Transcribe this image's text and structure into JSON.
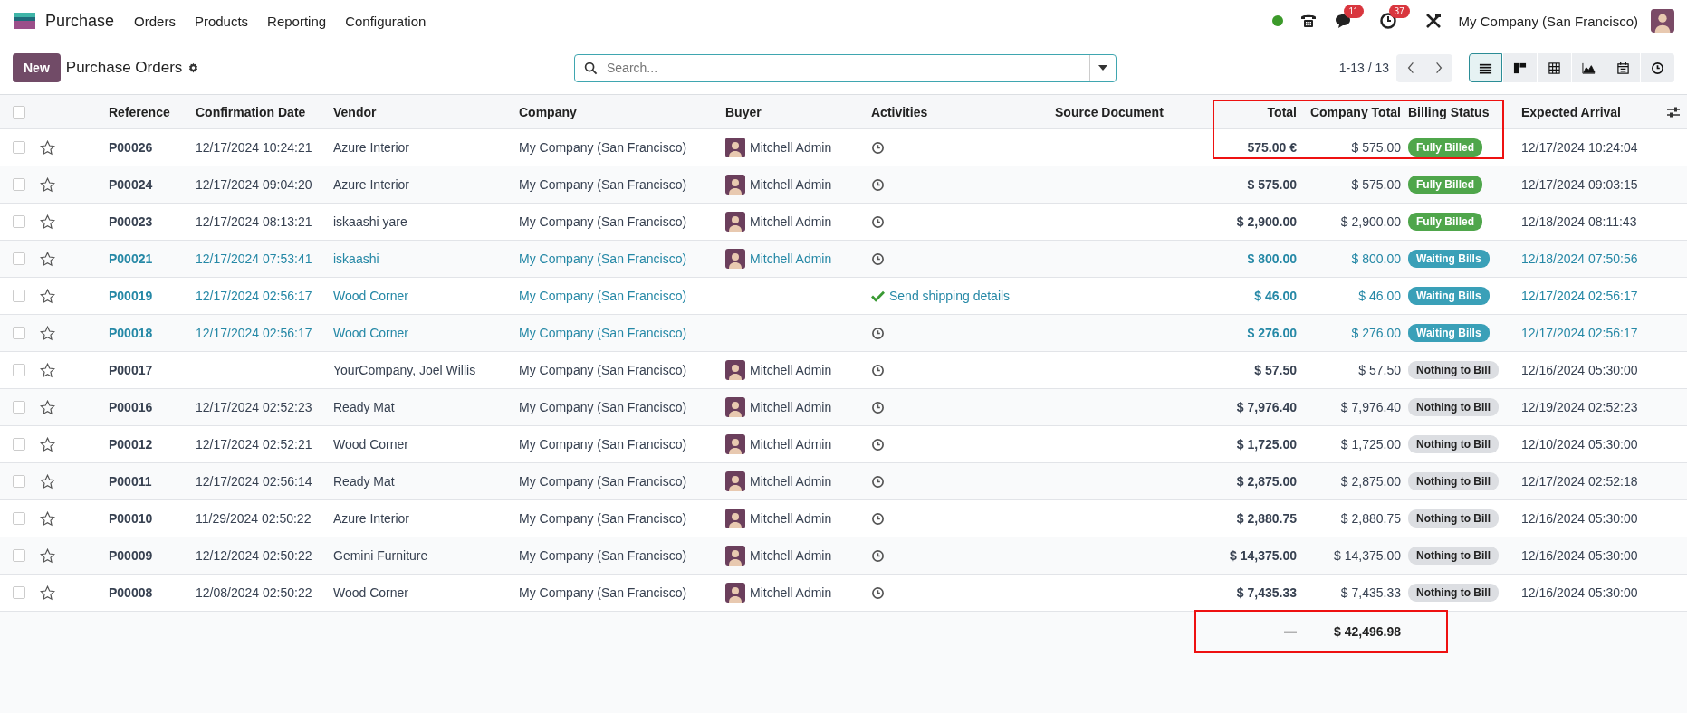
{
  "navbar": {
    "app_name": "Purchase",
    "menus": [
      "Orders",
      "Products",
      "Reporting",
      "Configuration"
    ],
    "status_online": true,
    "messages_count": "11",
    "activities_count": "37",
    "company": "My Company (San Francisco)"
  },
  "control_panel": {
    "new_button": "New",
    "title": "Purchase Orders",
    "search": {
      "placeholder": "Search..."
    },
    "pager": "1-13 / 13",
    "views": [
      {
        "kind": "list",
        "selected": true
      },
      {
        "kind": "kanban",
        "selected": false
      },
      {
        "kind": "pivot",
        "selected": false
      },
      {
        "kind": "graph",
        "selected": false
      },
      {
        "kind": "calendar",
        "selected": false
      },
      {
        "kind": "activity",
        "selected": false
      }
    ]
  },
  "table": {
    "header_checked": false,
    "columns": [
      "Reference",
      "Confirmation Date",
      "Vendor",
      "Company",
      "Buyer",
      "Activities",
      "Source Document",
      "Total",
      "Company Total",
      "Billing Status",
      "Expected Arrival"
    ],
    "rows": [
      {
        "checked": false,
        "starred": false,
        "highlighted": false,
        "reference": "P00026",
        "confirmation_date": "12/17/2024 10:24:21",
        "vendor": "Azure Interior",
        "company": "My Company (San Francisco)",
        "buyer": "Mitchell Admin",
        "activity": {
          "kind": "clock"
        },
        "total": "575.00 €",
        "company_total": "$ 575.00",
        "billing": {
          "label": "Fully Billed",
          "color": "#4fa64b"
        },
        "expected_arrival": "12/17/2024 10:24:04"
      },
      {
        "checked": false,
        "starred": false,
        "highlighted": false,
        "reference": "P00024",
        "confirmation_date": "12/17/2024 09:04:20",
        "vendor": "Azure Interior",
        "company": "My Company (San Francisco)",
        "buyer": "Mitchell Admin",
        "activity": {
          "kind": "clock"
        },
        "total": "$ 575.00",
        "company_total": "$ 575.00",
        "billing": {
          "label": "Fully Billed",
          "color": "#4fa64b"
        },
        "expected_arrival": "12/17/2024 09:03:15"
      },
      {
        "checked": false,
        "starred": false,
        "highlighted": false,
        "reference": "P00023",
        "confirmation_date": "12/17/2024 08:13:21",
        "vendor": "iskaashi yare",
        "company": "My Company (San Francisco)",
        "buyer": "Mitchell Admin",
        "activity": {
          "kind": "clock"
        },
        "total": "$ 2,900.00",
        "company_total": "$ 2,900.00",
        "billing": {
          "label": "Fully Billed",
          "color": "#4fa64b"
        },
        "expected_arrival": "12/18/2024 08:11:43"
      },
      {
        "checked": false,
        "starred": false,
        "highlighted": true,
        "reference": "P00021",
        "confirmation_date": "12/17/2024 07:53:41",
        "vendor": "iskaashi",
        "company": "My Company (San Francisco)",
        "buyer": "Mitchell Admin",
        "activity": {
          "kind": "clock"
        },
        "total": "$ 800.00",
        "company_total": "$ 800.00",
        "billing": {
          "label": "Waiting Bills",
          "color": "#3aa0b8"
        },
        "expected_arrival": "12/18/2024 07:50:56"
      },
      {
        "checked": false,
        "starred": false,
        "highlighted": true,
        "reference": "P00019",
        "confirmation_date": "12/17/2024 02:56:17",
        "vendor": "Wood Corner",
        "company": "My Company (San Francisco)",
        "activity": {
          "kind": "done",
          "label": "Send shipping details"
        },
        "total": "$ 46.00",
        "company_total": "$ 46.00",
        "billing": {
          "label": "Waiting Bills",
          "color": "#3aa0b8"
        },
        "expected_arrival": "12/17/2024 02:56:17"
      },
      {
        "checked": false,
        "starred": false,
        "highlighted": true,
        "reference": "P00018",
        "confirmation_date": "12/17/2024 02:56:17",
        "vendor": "Wood Corner",
        "company": "My Company (San Francisco)",
        "activity": {
          "kind": "clock"
        },
        "total": "$ 276.00",
        "company_total": "$ 276.00",
        "billing": {
          "label": "Waiting Bills",
          "color": "#3aa0b8"
        },
        "expected_arrival": "12/17/2024 02:56:17"
      },
      {
        "checked": false,
        "starred": false,
        "highlighted": false,
        "reference": "P00017",
        "vendor": "YourCompany, Joel Willis",
        "company": "My Company (San Francisco)",
        "buyer": "Mitchell Admin",
        "activity": {
          "kind": "clock"
        },
        "total": "$ 57.50",
        "company_total": "$ 57.50",
        "billing": {
          "label": "Nothing to Bill",
          "color": "#dcdee2"
        },
        "expected_arrival": "12/16/2024 05:30:00"
      },
      {
        "checked": false,
        "starred": false,
        "highlighted": false,
        "reference": "P00016",
        "confirmation_date": "12/17/2024 02:52:23",
        "vendor": "Ready Mat",
        "company": "My Company (San Francisco)",
        "buyer": "Mitchell Admin",
        "activity": {
          "kind": "clock"
        },
        "total": "$ 7,976.40",
        "company_total": "$ 7,976.40",
        "billing": {
          "label": "Nothing to Bill",
          "color": "#dcdee2"
        },
        "expected_arrival": "12/19/2024 02:52:23"
      },
      {
        "checked": false,
        "starred": false,
        "highlighted": false,
        "reference": "P00012",
        "confirmation_date": "12/17/2024 02:52:21",
        "vendor": "Wood Corner",
        "company": "My Company (San Francisco)",
        "buyer": "Mitchell Admin",
        "activity": {
          "kind": "clock"
        },
        "total": "$ 1,725.00",
        "company_total": "$ 1,725.00",
        "billing": {
          "label": "Nothing to Bill",
          "color": "#dcdee2"
        },
        "expected_arrival": "12/10/2024 05:30:00"
      },
      {
        "checked": false,
        "starred": false,
        "highlighted": false,
        "reference": "P00011",
        "confirmation_date": "12/17/2024 02:56:14",
        "vendor": "Ready Mat",
        "company": "My Company (San Francisco)",
        "buyer": "Mitchell Admin",
        "activity": {
          "kind": "clock"
        },
        "total": "$ 2,875.00",
        "company_total": "$ 2,875.00",
        "billing": {
          "label": "Nothing to Bill",
          "color": "#dcdee2"
        },
        "expected_arrival": "12/17/2024 02:52:18"
      },
      {
        "checked": false,
        "starred": false,
        "highlighted": false,
        "reference": "P00010",
        "confirmation_date": "11/29/2024 02:50:22",
        "vendor": "Azure Interior",
        "company": "My Company (San Francisco)",
        "buyer": "Mitchell Admin",
        "activity": {
          "kind": "clock"
        },
        "total": "$ 2,880.75",
        "company_total": "$ 2,880.75",
        "billing": {
          "label": "Nothing to Bill",
          "color": "#dcdee2"
        },
        "expected_arrival": "12/16/2024 05:30:00"
      },
      {
        "checked": false,
        "starred": false,
        "highlighted": false,
        "reference": "P00009",
        "confirmation_date": "12/12/2024 02:50:22",
        "vendor": "Gemini Furniture",
        "company": "My Company (San Francisco)",
        "buyer": "Mitchell Admin",
        "activity": {
          "kind": "clock"
        },
        "total": "$ 14,375.00",
        "company_total": "$ 14,375.00",
        "billing": {
          "label": "Nothing to Bill",
          "color": "#dcdee2"
        },
        "expected_arrival": "12/16/2024 05:30:00"
      },
      {
        "checked": false,
        "starred": false,
        "highlighted": false,
        "reference": "P00008",
        "confirmation_date": "12/08/2024 02:50:22",
        "vendor": "Wood Corner",
        "company": "My Company (San Francisco)",
        "buyer": "Mitchell Admin",
        "activity": {
          "kind": "clock"
        },
        "total": "$ 7,435.33",
        "company_total": "$ 7,435.33",
        "billing": {
          "label": "Nothing to Bill",
          "color": "#dcdee2"
        },
        "expected_arrival": "12/16/2024 05:30:00"
      }
    ],
    "footer": {
      "total": "—",
      "company_total": "$ 42,496.98"
    }
  },
  "annotations": {
    "header_and_first_row": true,
    "footer_totals": true
  }
}
